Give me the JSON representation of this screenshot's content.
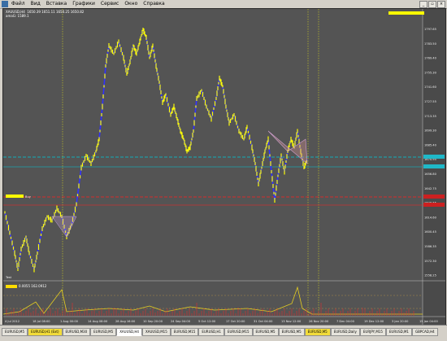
{
  "menu": {
    "items": [
      "Файл",
      "Вид",
      "Вставка",
      "Графики",
      "Сервис",
      "Окно",
      "Справка"
    ]
  },
  "chart": {
    "symbol_header": "XAUUSD,H4  1650.39 1651.11 1650.25 1650.82",
    "sub_header": "amaG: 1589.1",
    "price_labels": [
      "1797.65",
      "1783.50",
      "1769.40",
      "1755.30",
      "1741.60",
      "1727.55",
      "1713.35",
      "1699.30",
      "1685.40",
      "1670.95",
      "1656.80",
      "1642.75",
      "1628.65",
      "1614.60",
      "1600.45",
      "1586.35",
      "1572.30",
      "1558.25"
    ],
    "time_labels": [
      "4 Jul 2012",
      "18 Jul 08:00",
      "1 Aug 00:00",
      "14 Aug 08:00",
      "28 Aug 16:00",
      "10 Sep 20:00",
      "24 Sep 04:00",
      "5 Oct 12:00",
      "17 Oct 20:00",
      "31 Oct 04:00",
      "13 Nov 12:00",
      "26 Nov 20:00",
      "7 Dec 04:00",
      "19 Dec 12:00",
      "3 Jan 20:00",
      "15 Jan 04:00"
    ],
    "left_marker_label": "Buy",
    "bottom_label": "Test",
    "indicator_header": "0.0055  162.0912"
  },
  "colors": {
    "background": "#545454",
    "price_line": "#3232ff",
    "candles": "#ffff00",
    "cyan_levels": "#00c8d8",
    "red_level": "#ff2020",
    "vertical_dotted": "#d0d020"
  },
  "tabs": [
    "EURUSD,M5",
    "EURUSD,H1 (Ext)",
    "EURUSD,M30",
    "EURUSD,M5",
    "XAUUSD,H4",
    "XAUUSD,M15",
    "EURUSD,M15",
    "EURUSD,H1",
    "EURUSD,M15",
    "EURUSD,M5",
    "EURUSD,M5",
    "EURUSD,M5",
    "EURUSD,Daily",
    "EURJPY,M15",
    "EURUSD,M1",
    "GBPCAD,H4"
  ],
  "active_tab_index": 4
}
